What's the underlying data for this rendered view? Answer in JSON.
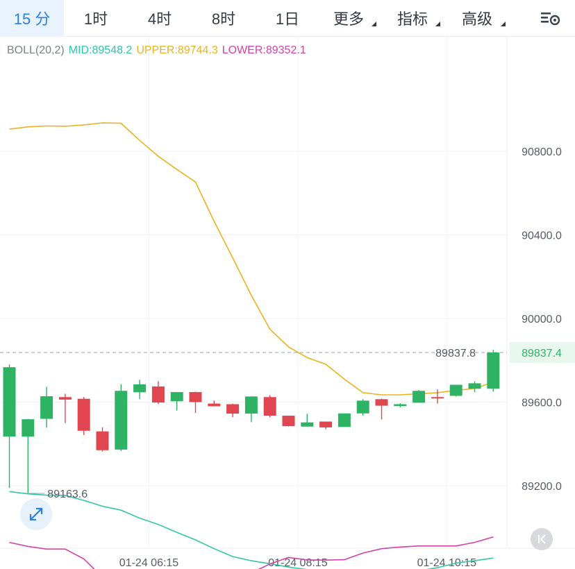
{
  "tabs": [
    {
      "label": "15 分",
      "active": true
    },
    {
      "label": "1时"
    },
    {
      "label": "4时"
    },
    {
      "label": "8时"
    },
    {
      "label": "1日"
    },
    {
      "label": "更多",
      "dropdown": true
    },
    {
      "label": "指标",
      "dropdown": true
    },
    {
      "label": "高级",
      "dropdown": true
    }
  ],
  "settings_icon": "chart-settings-icon",
  "legend": {
    "name": "BOLL(20,2)",
    "mid": "MID:89548.2",
    "upper": "UPPER:89744.3",
    "lower": "LOWER:89352.1"
  },
  "colors": {
    "up": "#2eb365",
    "down": "#e0464f",
    "mid": "#2ec7a6",
    "upper": "#e8b31e",
    "lower": "#d640a7",
    "accent": "#2a7fe0",
    "axis_text": "#555b66",
    "last_price_text": "#2eb365"
  },
  "chart_data": {
    "type": "candlestick",
    "indicator": "BOLL(20,2)",
    "ylim": [
      89000,
      91200
    ],
    "y_ticks": [
      89200,
      89600,
      90000,
      90400,
      90800
    ],
    "y_tick_labels": [
      "89200.0",
      "89600.0",
      "90000.0",
      "90400.0",
      "90800.0"
    ],
    "x_ticks": [
      {
        "index": 7.5,
        "label": "01-24 06:15"
      },
      {
        "index": 15.5,
        "label": "01-24 08:15"
      },
      {
        "index": 23.5,
        "label": "01-24 10:15"
      }
    ],
    "candles": [
      {
        "o": 89435,
        "h": 89780,
        "l": 89190,
        "c": 89767
      },
      {
        "o": 89435,
        "h": 89520,
        "l": 89163.6,
        "c": 89518
      },
      {
        "o": 89520,
        "h": 89673,
        "l": 89478,
        "c": 89628
      },
      {
        "o": 89624,
        "h": 89640,
        "l": 89500,
        "c": 89612
      },
      {
        "o": 89616,
        "h": 89624,
        "l": 89443,
        "c": 89463
      },
      {
        "o": 89460,
        "h": 89480,
        "l": 89364,
        "c": 89370
      },
      {
        "o": 89373,
        "h": 89686,
        "l": 89367,
        "c": 89654
      },
      {
        "o": 89647,
        "h": 89707,
        "l": 89614,
        "c": 89685
      },
      {
        "o": 89675,
        "h": 89700,
        "l": 89590,
        "c": 89598
      },
      {
        "o": 89604,
        "h": 89620,
        "l": 89560,
        "c": 89648
      },
      {
        "o": 89648,
        "h": 89650,
        "l": 89548,
        "c": 89600
      },
      {
        "o": 89593,
        "h": 89607,
        "l": 89587,
        "c": 89580
      },
      {
        "o": 89590,
        "h": 89593,
        "l": 89528,
        "c": 89545
      },
      {
        "o": 89545,
        "h": 89594,
        "l": 89504,
        "c": 89627
      },
      {
        "o": 89624,
        "h": 89633,
        "l": 89528,
        "c": 89535
      },
      {
        "o": 89535,
        "h": 89530,
        "l": 89483,
        "c": 89485
      },
      {
        "o": 89483,
        "h": 89544,
        "l": 89483,
        "c": 89503
      },
      {
        "o": 89507,
        "h": 89507,
        "l": 89470,
        "c": 89479
      },
      {
        "o": 89481,
        "h": 89507,
        "l": 89481,
        "c": 89546
      },
      {
        "o": 89546,
        "h": 89614,
        "l": 89536,
        "c": 89607
      },
      {
        "o": 89614,
        "h": 89617,
        "l": 89517,
        "c": 89583
      },
      {
        "o": 89581,
        "h": 89595,
        "l": 89575,
        "c": 89590
      },
      {
        "o": 89597,
        "h": 89658,
        "l": 89597,
        "c": 89654
      },
      {
        "o": 89624,
        "h": 89661,
        "l": 89593,
        "c": 89618
      },
      {
        "o": 89630,
        "h": 89682,
        "l": 89627,
        "c": 89683
      },
      {
        "o": 89664,
        "h": 89700,
        "l": 89648,
        "c": 89690
      },
      {
        "o": 89664,
        "h": 89850,
        "l": 89650,
        "c": 89837.4
      }
    ],
    "boll_mid": [
      89172,
      89161,
      89155,
      89154,
      89130,
      89102,
      89083,
      89045,
      89015,
      88977,
      88941,
      88899,
      88861,
      88841,
      88827,
      88811,
      88799,
      88789,
      88779,
      88790,
      88793,
      88796,
      88793,
      88808,
      88830,
      88841,
      88854
    ],
    "boll_upper": [
      90906,
      90917,
      90921,
      90920,
      90926,
      90936,
      90934,
      90852,
      90776,
      90713,
      90653,
      90465,
      90290,
      90111,
      89949,
      89864,
      89813,
      89781,
      89710,
      89645,
      89635,
      89635,
      89640,
      89645,
      89656,
      89665,
      89695
    ],
    "boll_lower": [
      88929,
      88910,
      88897,
      88897,
      88850,
      88762,
      88712,
      88685,
      88697,
      88697,
      88692,
      88705,
      88740,
      88783,
      88826,
      88857,
      88845,
      88844,
      88846,
      88878,
      88899,
      88907,
      88912,
      88912,
      88912,
      88929,
      88955
    ],
    "last_price": 89837.4,
    "last_price_label": "89837.4",
    "mark_line_label": "89837.8",
    "min_low_label": "89163.6"
  }
}
